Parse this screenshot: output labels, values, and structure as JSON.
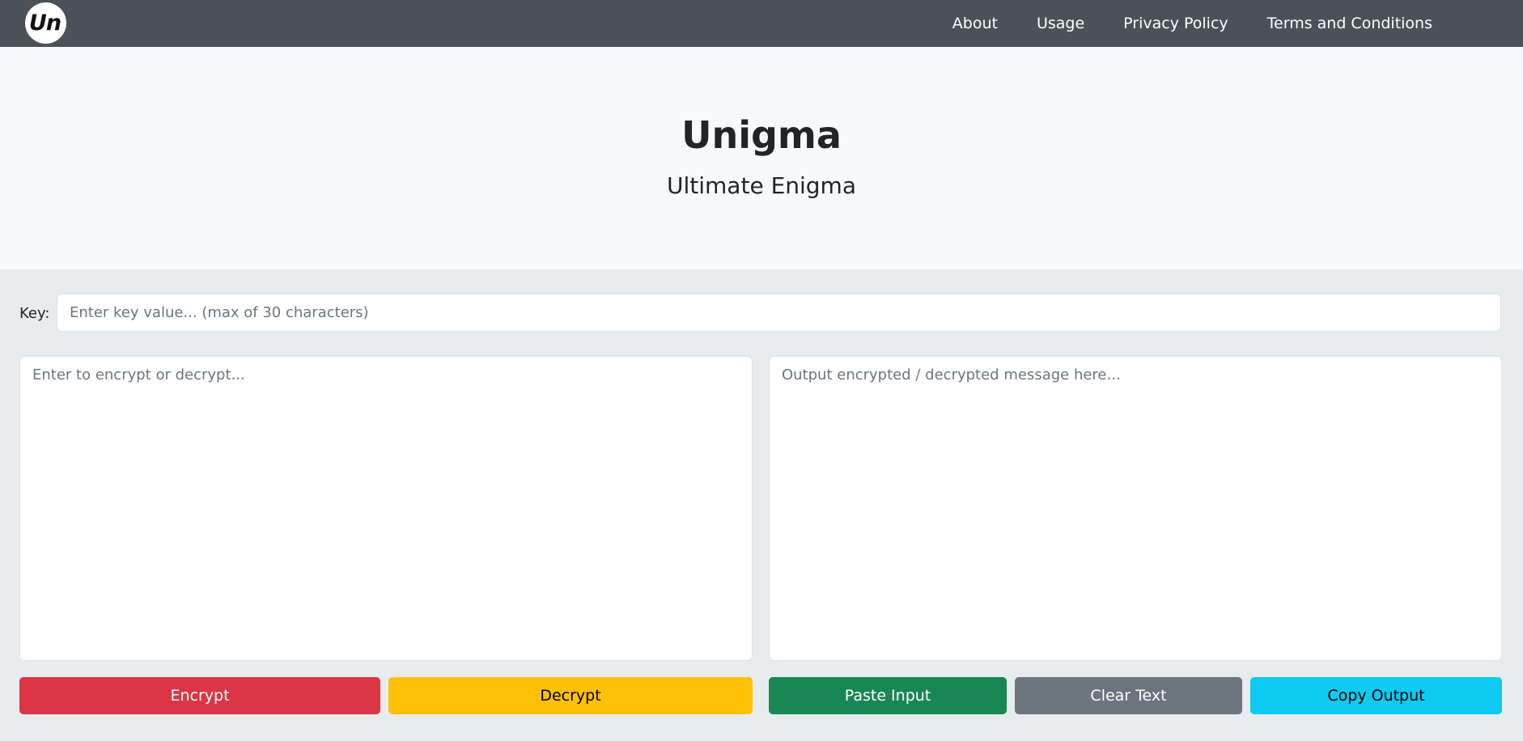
{
  "navbar": {
    "logo_text": "Un",
    "links": [
      {
        "label": "About"
      },
      {
        "label": "Usage"
      },
      {
        "label": "Privacy Policy"
      },
      {
        "label": "Terms and Conditions"
      }
    ],
    "background_color": "#4b5159"
  },
  "hero": {
    "title": "Unigma",
    "subtitle": "Ultimate Enigma"
  },
  "form": {
    "key_label": "Key:",
    "key_placeholder": "Enter key value... (max of 30 characters)",
    "key_value": "",
    "input_placeholder": "Enter to encrypt or decrypt...",
    "input_value": "",
    "output_placeholder": "Output encrypted / decrypted message here...",
    "output_value": ""
  },
  "buttons": {
    "encrypt": {
      "label": "Encrypt",
      "color": "#dc3545"
    },
    "decrypt": {
      "label": "Decrypt",
      "color": "#ffc107"
    },
    "paste": {
      "label": "Paste Input",
      "color": "#198754"
    },
    "clear": {
      "label": "Clear Text",
      "color": "#6c757d"
    },
    "copy": {
      "label": "Copy Output",
      "color": "#0dcaf0"
    }
  }
}
